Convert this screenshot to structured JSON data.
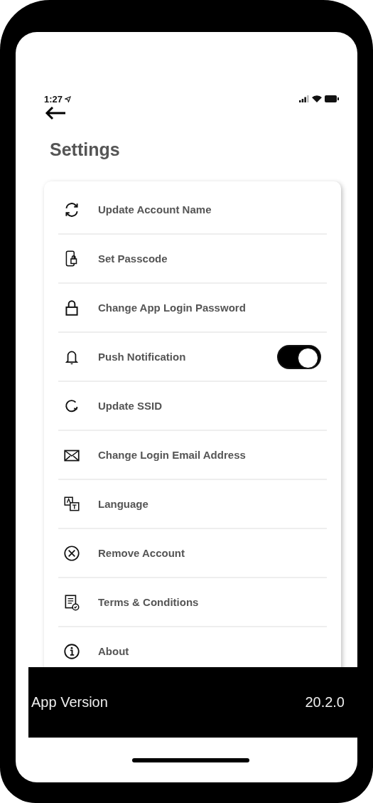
{
  "status_bar": {
    "time": "1:27"
  },
  "title": "Settings",
  "items": [
    {
      "label": "Update Account Name",
      "kind": "link"
    },
    {
      "label": "Set Passcode",
      "kind": "link"
    },
    {
      "label": "Change App Login Password",
      "kind": "link"
    },
    {
      "label": "Push Notification",
      "kind": "toggle",
      "on": true
    },
    {
      "label": "Update SSID",
      "kind": "link"
    },
    {
      "label": "Change Login Email Address",
      "kind": "link"
    },
    {
      "label": "Language",
      "kind": "link"
    },
    {
      "label": "Remove Account",
      "kind": "link"
    },
    {
      "label": "Terms & Conditions",
      "kind": "link"
    },
    {
      "label": "About",
      "kind": "link"
    }
  ],
  "footer": {
    "label": "App Version",
    "value": "20.2.0"
  }
}
